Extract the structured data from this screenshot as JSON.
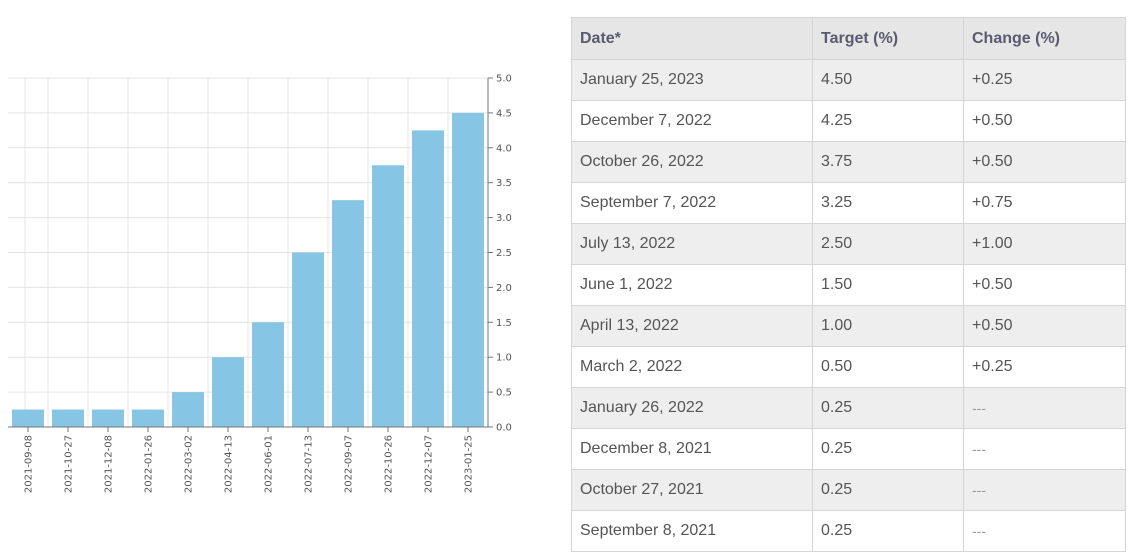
{
  "chart_data": {
    "type": "bar",
    "categories": [
      "2021-09-08",
      "2021-10-27",
      "2021-12-08",
      "2022-01-26",
      "2022-03-02",
      "2022-04-13",
      "2022-06-01",
      "2022-07-13",
      "2022-09-07",
      "2022-10-26",
      "2022-12-07",
      "2023-01-25"
    ],
    "values": [
      0.25,
      0.25,
      0.25,
      0.25,
      0.5,
      1.0,
      1.5,
      2.5,
      3.25,
      3.75,
      4.25,
      4.5
    ],
    "ylim": [
      0,
      5.0
    ],
    "yticks": [
      "0.0",
      "0.5",
      "1.0",
      "1.5",
      "2.0",
      "2.5",
      "3.0",
      "3.5",
      "4.0",
      "4.5",
      "5.0"
    ],
    "grid": true,
    "y_axis_side": "right",
    "bar_color": "#86c5e3"
  },
  "table": {
    "headers": [
      "Date*",
      "Target (%)",
      "Change (%)"
    ],
    "rows": [
      [
        "January 25, 2023",
        "4.50",
        "+0.25"
      ],
      [
        "December 7, 2022",
        "4.25",
        "+0.50"
      ],
      [
        "October 26, 2022",
        "3.75",
        "+0.50"
      ],
      [
        "September 7, 2022",
        "3.25",
        "+0.75"
      ],
      [
        "July 13, 2022",
        "2.50",
        "+1.00"
      ],
      [
        "June 1, 2022",
        "1.50",
        "+0.50"
      ],
      [
        "April 13, 2022",
        "1.00",
        "+0.50"
      ],
      [
        "March 2, 2022",
        "0.50",
        "+0.25"
      ],
      [
        "January 26, 2022",
        "0.25",
        "---"
      ],
      [
        "December 8, 2021",
        "0.25",
        "---"
      ],
      [
        "October 27, 2021",
        "0.25",
        "---"
      ],
      [
        "September 8, 2021",
        "0.25",
        "---"
      ]
    ]
  }
}
